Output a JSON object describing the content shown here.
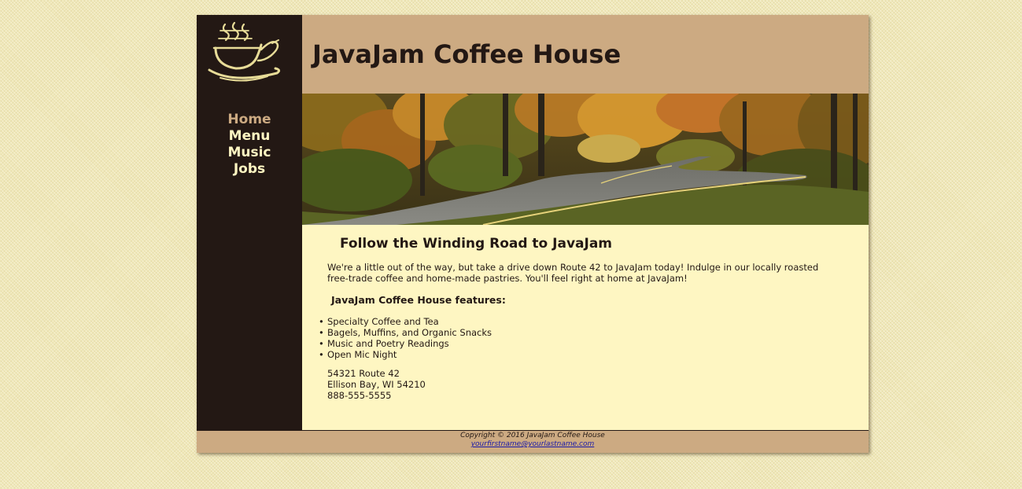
{
  "header": {
    "title": "JavaJam Coffee House"
  },
  "logo": {
    "icon": "coffee-cup-icon"
  },
  "nav": {
    "items": [
      {
        "label": "Home",
        "current": true
      },
      {
        "label": "Menu",
        "current": false
      },
      {
        "label": "Music",
        "current": false
      },
      {
        "label": "Jobs",
        "current": false
      }
    ]
  },
  "hero": {
    "icon": "winding-road-image"
  },
  "content": {
    "heading": "Follow the Winding Road to JavaJam",
    "intro": "We're a little out of the way, but take a drive down Route 42 to JavaJam today! Indulge in our locally roasted free-trade coffee and home-made pastries. You'll feel right at home at JavaJam!",
    "features_heading": "JavaJam Coffee House features:",
    "features": [
      "Specialty Coffee and Tea",
      "Bagels, Muffins, and Organic Snacks",
      "Music and Poetry Readings",
      "Open Mic Night"
    ],
    "address": {
      "line1": "54321 Route 42",
      "line2": "Ellison Bay, WI 54210",
      "phone": "888-555-5555"
    }
  },
  "footer": {
    "copyright": "Copyright © 2016 JavaJam Coffee House",
    "email": "yourfirstname@yourlastname.com"
  },
  "colors": {
    "page_background": "#f0e8b8",
    "dark_brown": "#231814",
    "tan": "#ccaa82",
    "cream": "#fef6c2",
    "link_blue": "#1a1aa8"
  }
}
